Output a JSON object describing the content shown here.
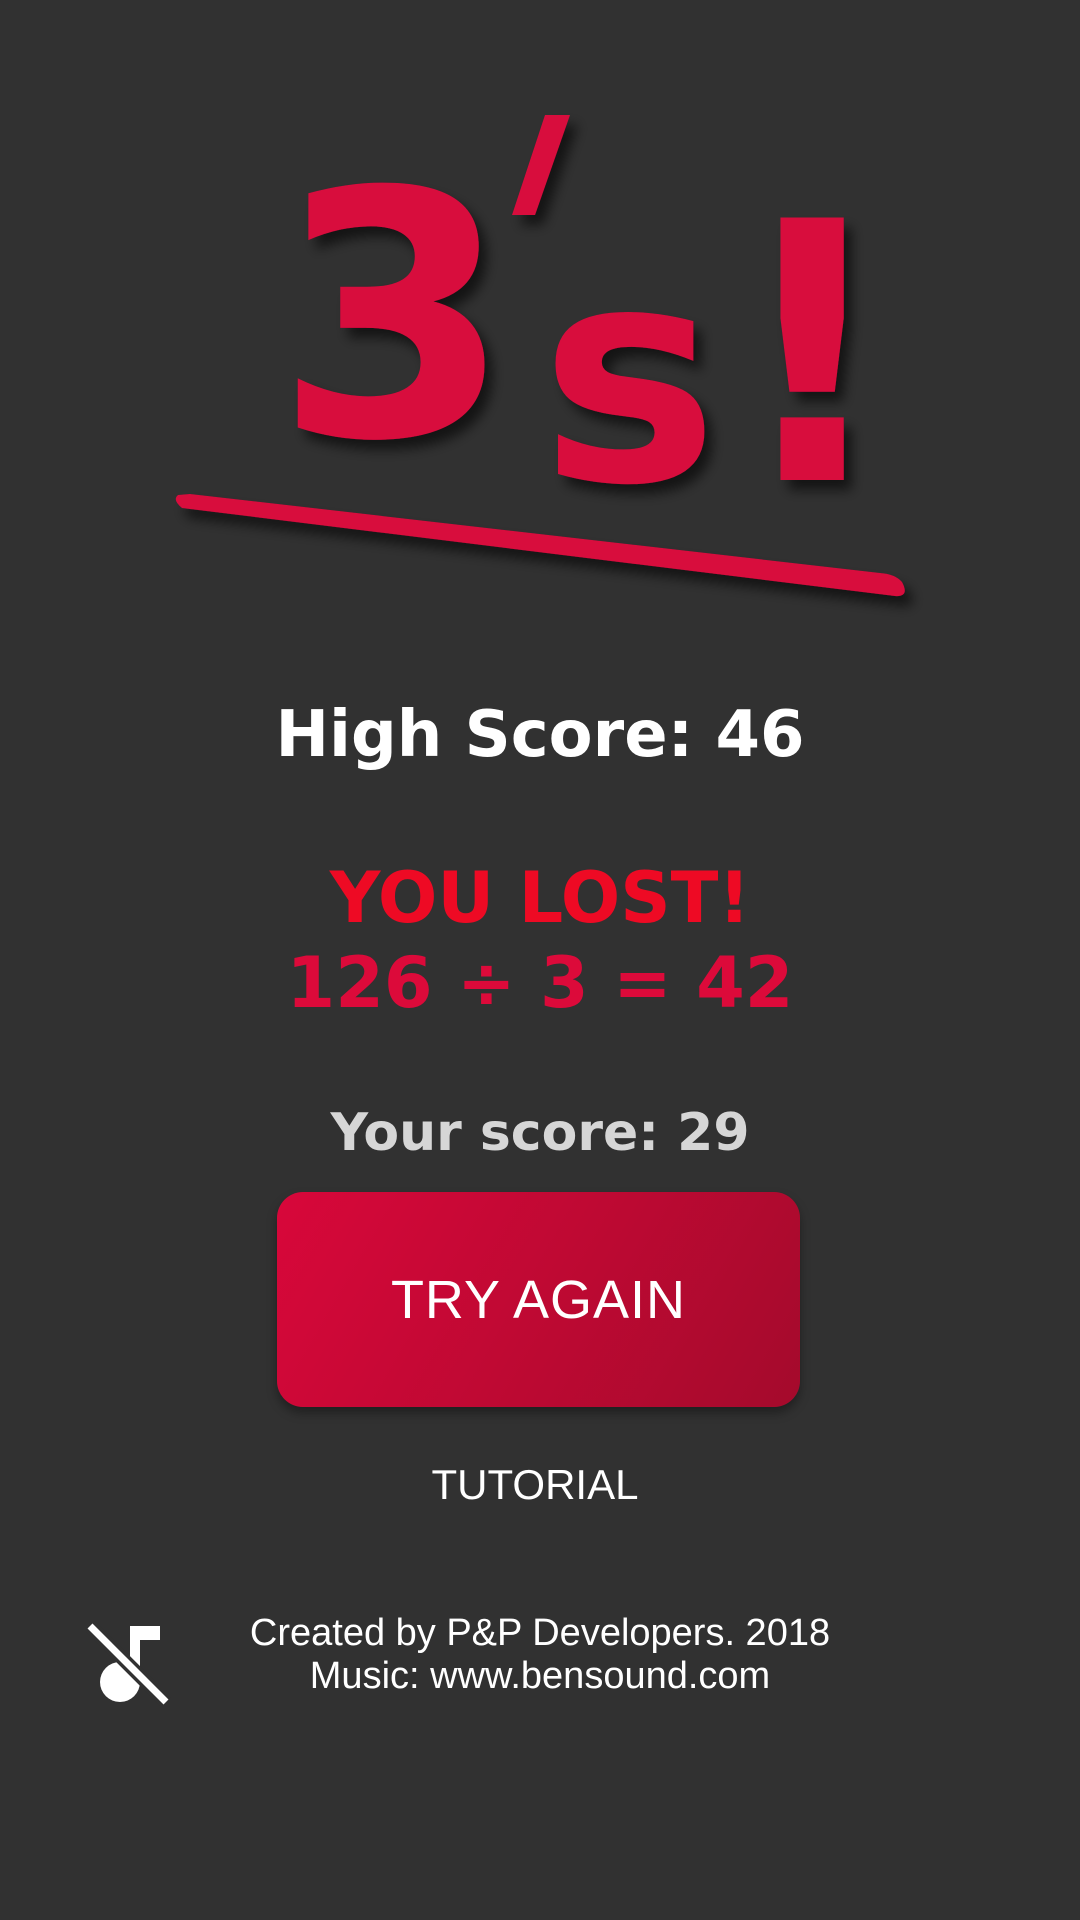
{
  "app": {
    "logo_text": "3's!",
    "accent_color": "#dc0a3a"
  },
  "high_score": {
    "text": "High Score: 46"
  },
  "result": {
    "title": "YOU LOST!",
    "equation": "126 ÷ 3 = 42"
  },
  "current_score": {
    "text": "Your score: 29"
  },
  "actions": {
    "try_again_label": "TRY AGAIN",
    "tutorial_label": "TUTORIAL",
    "mute_icon": "music-off-icon"
  },
  "footer": {
    "credit_line": "Created by P&P Developers. 2018",
    "music_line": "Music: www.bensound.com"
  }
}
